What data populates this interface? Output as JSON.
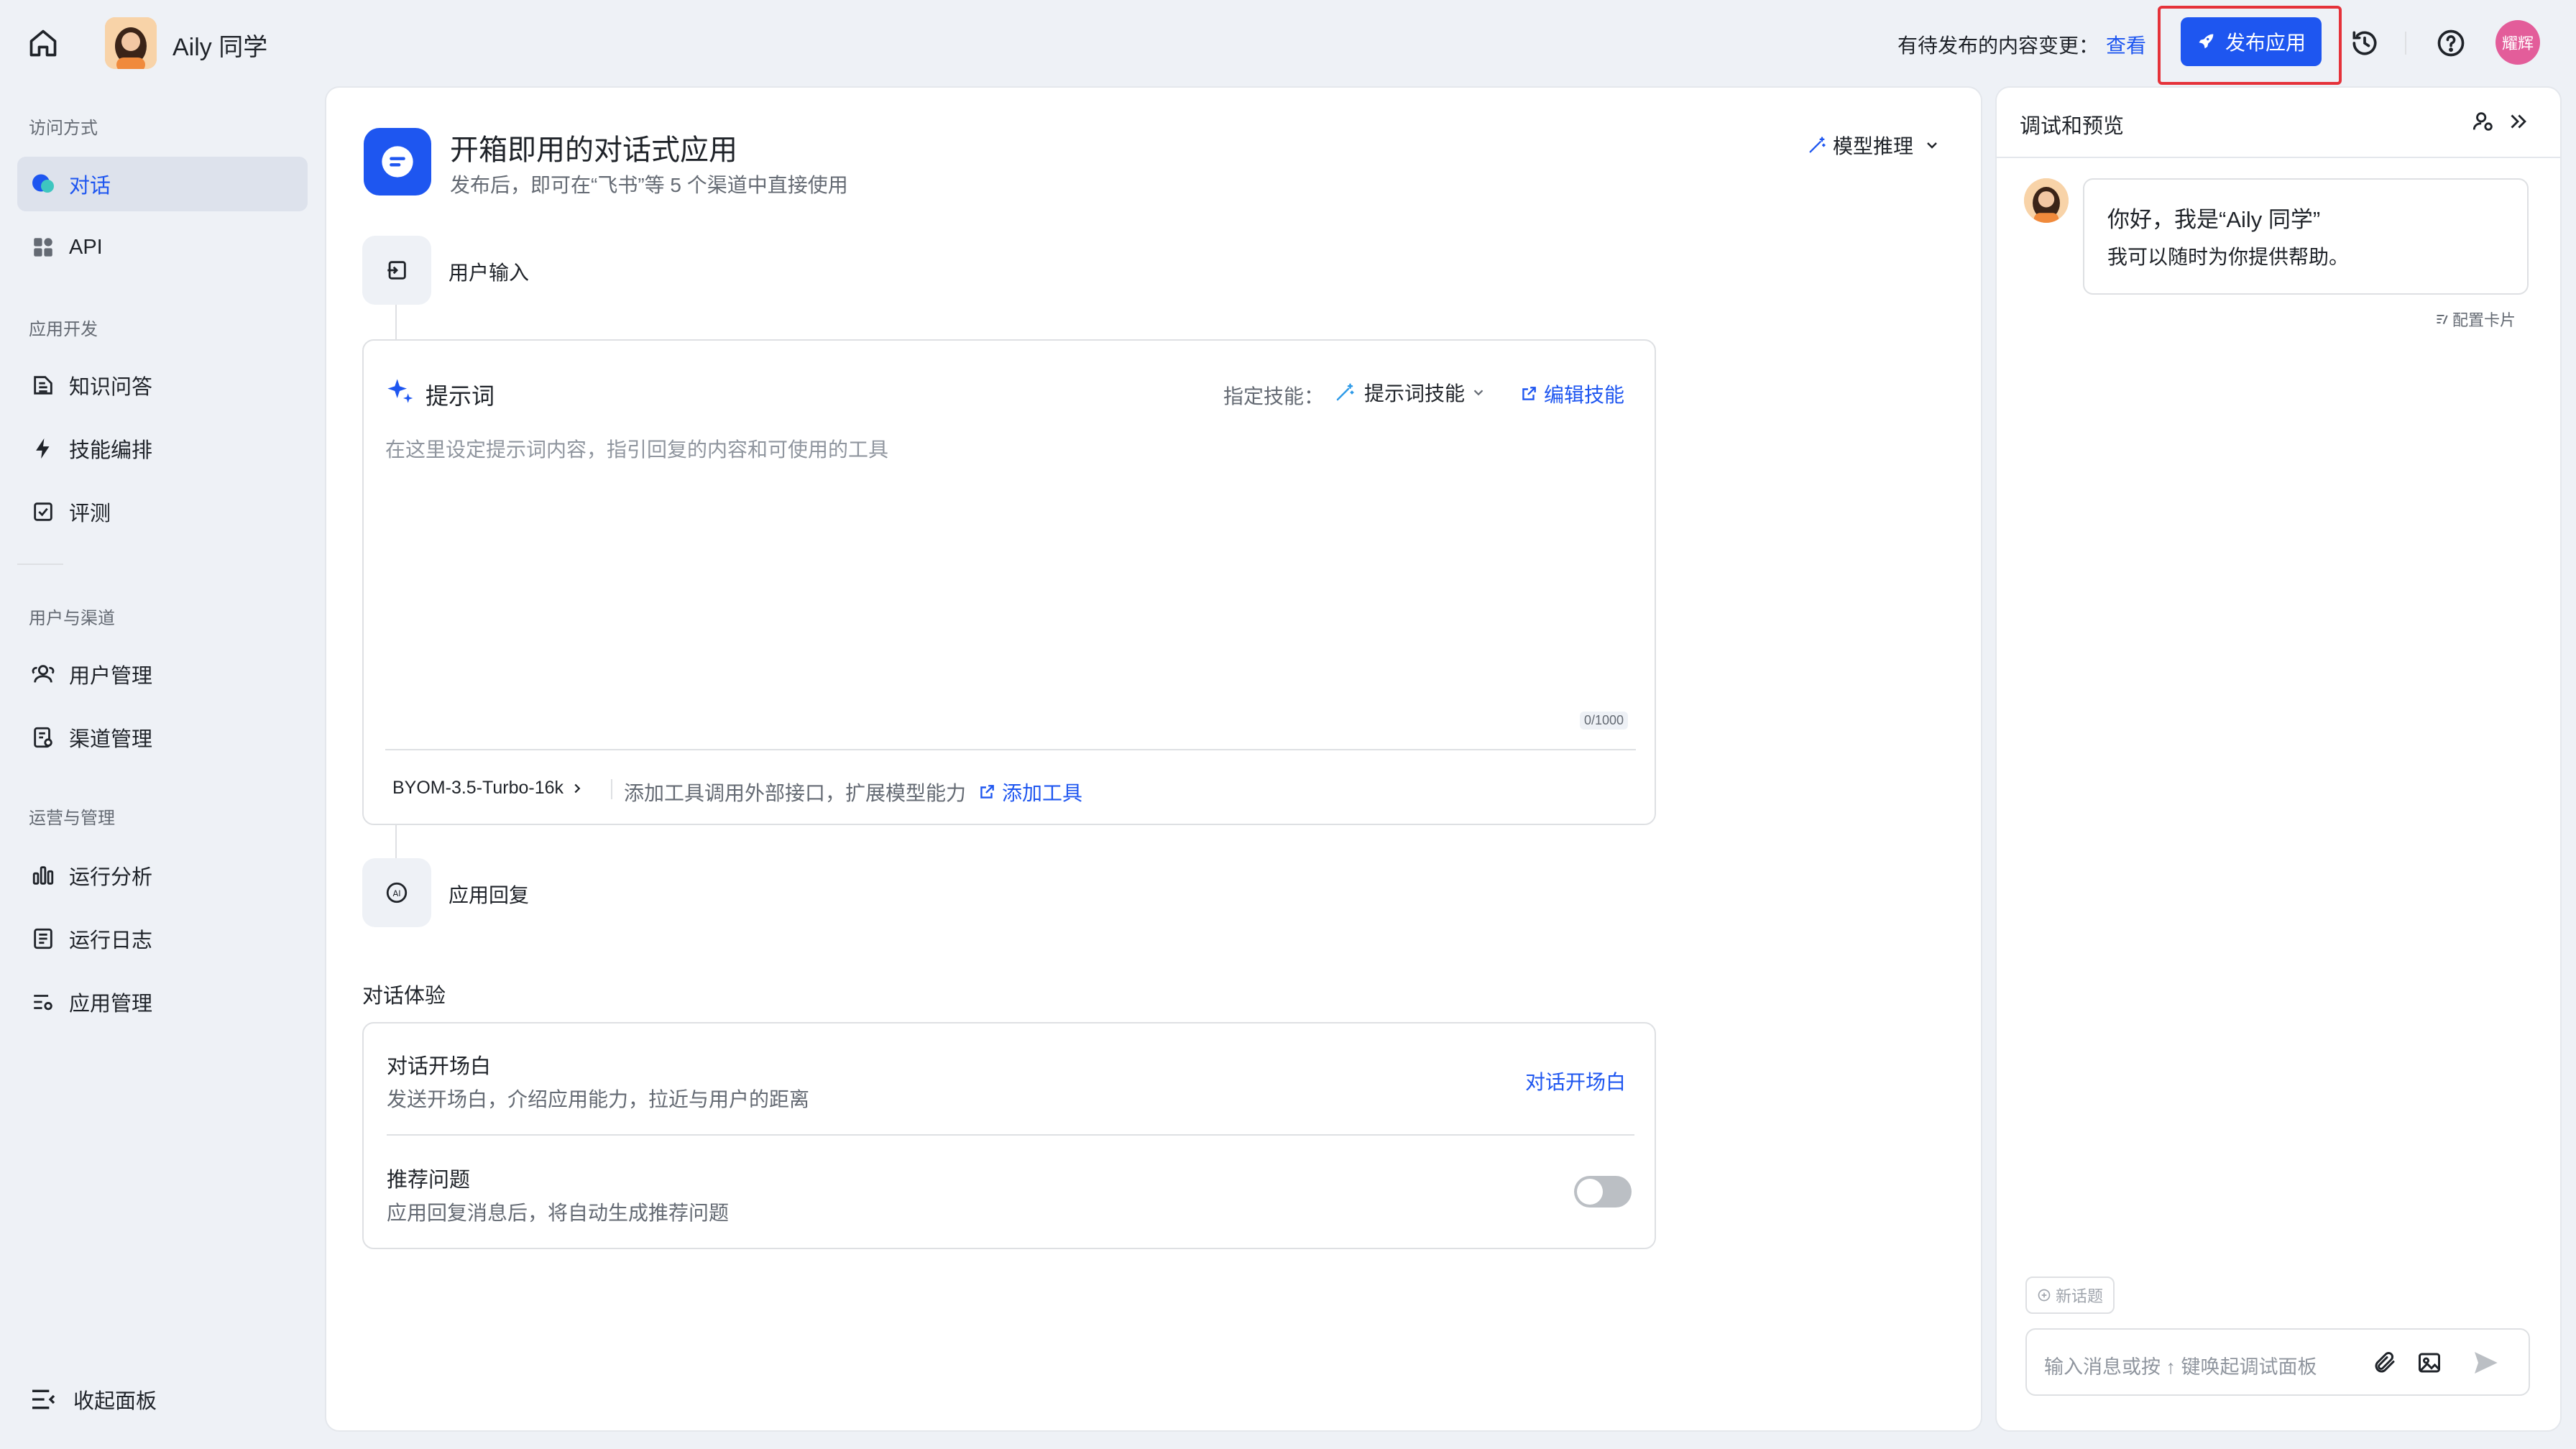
{
  "header": {
    "app_name": "Aily 同学",
    "pending_label": "有待发布的内容变更：",
    "view_link": "查看",
    "publish_button": "发布应用",
    "user_badge": "耀辉",
    "icons": [
      "home-icon",
      "history-icon",
      "help-icon"
    ]
  },
  "sidebar": {
    "sections": [
      {
        "title": "访问方式",
        "items": [
          {
            "label": "对话",
            "icon": "chat-bubble-icon",
            "active": true
          },
          {
            "label": "API",
            "icon": "api-grid-icon"
          }
        ]
      },
      {
        "title": "应用开发",
        "items": [
          {
            "label": "知识问答",
            "icon": "knowledge-icon"
          },
          {
            "label": "技能编排",
            "icon": "lightning-icon"
          },
          {
            "label": "评测",
            "icon": "check-box-icon"
          }
        ]
      },
      {
        "title": "用户与渠道",
        "items": [
          {
            "label": "用户管理",
            "icon": "users-icon"
          },
          {
            "label": "渠道管理",
            "icon": "channel-icon"
          }
        ]
      },
      {
        "title": "运营与管理",
        "items": [
          {
            "label": "运行分析",
            "icon": "bar-chart-icon"
          },
          {
            "label": "运行日志",
            "icon": "log-icon"
          },
          {
            "label": "应用管理",
            "icon": "app-settings-icon"
          }
        ]
      }
    ],
    "collapse_label": "收起面板"
  },
  "main": {
    "title": "开箱即用的对话式应用",
    "subtitle": "发布后，即可在“飞书”等 5 个渠道中直接使用",
    "model_reasoning": "模型推理",
    "user_input_label": "用户输入",
    "prompt": {
      "title": "提示词",
      "skill_label": "指定技能：",
      "skill_value": "提示词技能",
      "edit_skill": "编辑技能",
      "placeholder": "在这里设定提示词内容，指引回复的内容和可使用的工具",
      "counter": "0/1000",
      "model": "BYOM-3.5-Turbo-16k",
      "tools_hint": "添加工具调用外部接口，扩展模型能力",
      "add_tool": "添加工具"
    },
    "app_reply_label": "应用回复",
    "dialog_section_title": "对话体验",
    "opening": {
      "title": "对话开场白",
      "desc": "发送开场白，介绍应用能力，拉近与用户的距离",
      "action": "对话开场白"
    },
    "suggest": {
      "title": "推荐问题",
      "desc": "应用回复消息后，将自动生成推荐问题",
      "enabled": false
    }
  },
  "preview": {
    "title": "调试和预览",
    "greeting_title": "你好，我是“Aily 同学”",
    "greeting_text": "我可以随时为你提供帮助。",
    "config_card": "配置卡片",
    "new_topic": "新话题",
    "input_placeholder": "输入消息或按 ↑ 键唤起调试面板"
  },
  "colors": {
    "accent": "#1e56f0",
    "highlight_border": "#e5323a",
    "background": "#eef1f6"
  }
}
